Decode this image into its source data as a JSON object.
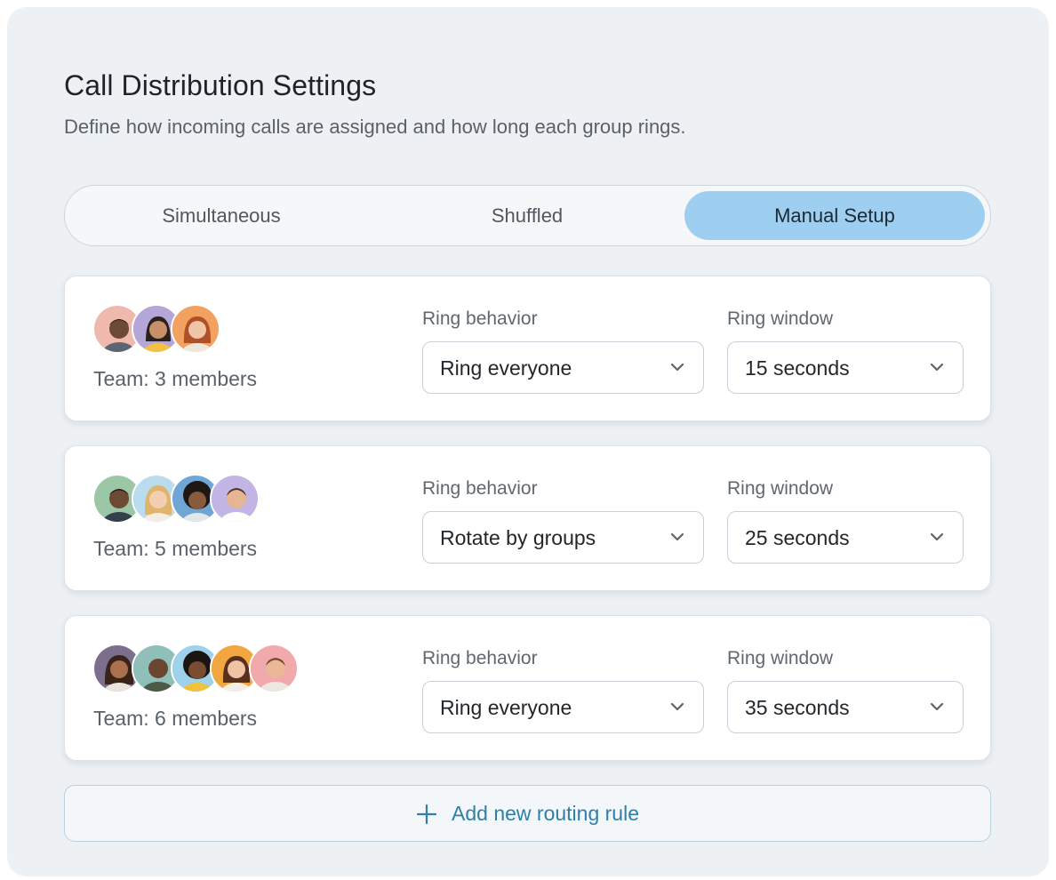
{
  "header": {
    "title": "Call Distribution Settings",
    "subtitle": "Define how incoming calls are assigned and how long each group rings."
  },
  "tabs": [
    {
      "label": "Simultaneous",
      "active": false
    },
    {
      "label": "Shuffled",
      "active": false
    },
    {
      "label": "Manual Setup",
      "active": true
    }
  ],
  "rules": [
    {
      "team_label": "Team: 3 members",
      "behavior_label": "Ring behavior",
      "behavior_value": "Ring everyone",
      "window_label": "Ring window",
      "window_value": "15 seconds"
    },
    {
      "team_label": "Team: 5 members",
      "behavior_label": "Ring behavior",
      "behavior_value": "Rotate by groups",
      "window_label": "Ring window",
      "window_value": "25 seconds"
    },
    {
      "team_label": "Team: 6 members",
      "behavior_label": "Ring behavior",
      "behavior_value": "Ring everyone",
      "window_label": "Ring window",
      "window_value": "35 seconds"
    }
  ],
  "add_rule": {
    "label": "Add new routing rule",
    "icon": "plus-icon"
  },
  "colors": {
    "active_tab": "#9fcff0",
    "accent_text": "#2f7fa8",
    "panel_bg": "#eef1f4"
  }
}
